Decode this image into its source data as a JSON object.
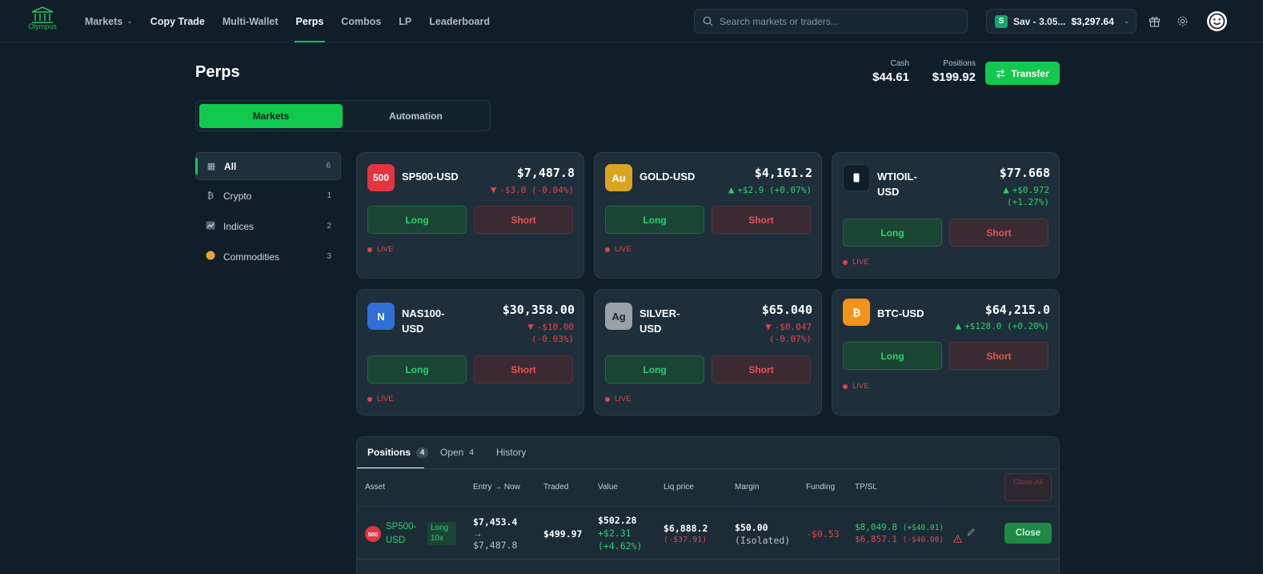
{
  "nav": {
    "logo_text": "Olympus",
    "links": [
      {
        "label": "Markets",
        "dropdown": true
      },
      {
        "label": "Copy Trade"
      },
      {
        "label": "Multi-Wallet"
      },
      {
        "label": "Perps",
        "active": true
      },
      {
        "label": "Combos"
      },
      {
        "label": "LP"
      },
      {
        "label": "Leaderboard"
      }
    ],
    "search_placeholder": "Search markets or traders...",
    "wallet": {
      "badge": "S",
      "name": "Sav - 3.05...",
      "balance": "$3,297.64"
    },
    "icons": [
      "gift-icon",
      "settings-icon",
      "avatar-smiley-icon"
    ]
  },
  "header": {
    "title": "Perps",
    "cash_label": "Cash",
    "cash_value": "$44.61",
    "positions_label": "Positions",
    "positions_value": "$199.92",
    "transfer_label": "Transfer"
  },
  "segments": {
    "markets": "Markets",
    "automation": "Automation",
    "selected": "Markets"
  },
  "categories": [
    {
      "label": "All",
      "count": "6",
      "icon": "grid-icon",
      "active": true
    },
    {
      "label": "Crypto",
      "count": "1",
      "icon": "bitcoin-icon"
    },
    {
      "label": "Indices",
      "count": "2",
      "icon": "chart-icon"
    },
    {
      "label": "Commodities",
      "count": "3",
      "icon": "coin-icon"
    }
  ],
  "markets": [
    {
      "icon_text": "500",
      "name": "SP500-USD",
      "price": "$7,487.8",
      "change1": "-$3.0 (-0.04%)",
      "change2": "",
      "direction": "down",
      "long": "Long",
      "short": "Short",
      "status": "LIVE"
    },
    {
      "icon_text": "Au",
      "name": "GOLD-USD",
      "price": "$4,161.2",
      "change1": "+$2.9 (+0.07%)",
      "change2": "",
      "direction": "up",
      "long": "Long",
      "short": "Short",
      "status": "LIVE"
    },
    {
      "icon_text": "",
      "name": "WTIOIL-USD",
      "price": "$77.668",
      "change1": "+$0.972",
      "change2": "(+1.27%)",
      "direction": "up",
      "long": "Long",
      "short": "Short",
      "status": "LIVE"
    },
    {
      "icon_text": "N",
      "name": "NAS100-USD",
      "price": "$30,358.00",
      "change1": "-$10.00",
      "change2": "(-0.03%)",
      "direction": "down",
      "long": "Long",
      "short": "Short",
      "status": "LIVE"
    },
    {
      "icon_text": "Ag",
      "name": "SILVER-USD",
      "price": "$65.040",
      "change1": "-$0.047",
      "change2": "(-0.07%)",
      "direction": "down",
      "long": "Long",
      "short": "Short",
      "status": "LIVE"
    },
    {
      "icon_text": "₿",
      "name": "BTC-USD",
      "price": "$64,215.0",
      "change1": "+$128.0 (+0.20%)",
      "change2": "",
      "direction": "up",
      "long": "Long",
      "short": "Short",
      "status": "LIVE"
    }
  ],
  "colors": {
    "accent": "#13c84f",
    "down": "#e2454b",
    "up": "#2bd36a",
    "sp500_icon": "#e2353f",
    "gold_icon": "#d9a521",
    "oil_icon": "#0f1e29",
    "nas_icon": "#2f6fd6",
    "silver_icon": "#9aa1a8",
    "btc_icon": "#f2931a"
  },
  "positions": {
    "tabs": [
      {
        "label": "Positions",
        "count": "4",
        "active": true
      },
      {
        "label": "Open",
        "count": "4"
      },
      {
        "label": "History",
        "count": ""
      }
    ],
    "columns": [
      "Asset",
      "Entry → Now",
      "Traded",
      "Value",
      "Liq price",
      "Margin",
      "Funding",
      "TP/SL"
    ],
    "close_all": "Close All",
    "rows": [
      {
        "icon_text": "500",
        "asset": "SP500-USD",
        "side": "Long 10x",
        "entry": "$7,453.4",
        "arrow": "→",
        "now": "$7,487.8",
        "traded": "$499.97",
        "value": "$502.28",
        "value_chg": "+$2.31",
        "value_pct": "(+4.62%)",
        "liq": "$6,888.2",
        "liq_diff": "(-$37.91)",
        "margin": "$50.00",
        "margin_type": "(Isolated)",
        "funding": "-$0.53",
        "tp": "$8,049.8",
        "tp_diff": "(+$40.01)",
        "sl": "$6,857.1",
        "sl_diff": "(-$40.00)",
        "close_label": "Close"
      }
    ]
  }
}
